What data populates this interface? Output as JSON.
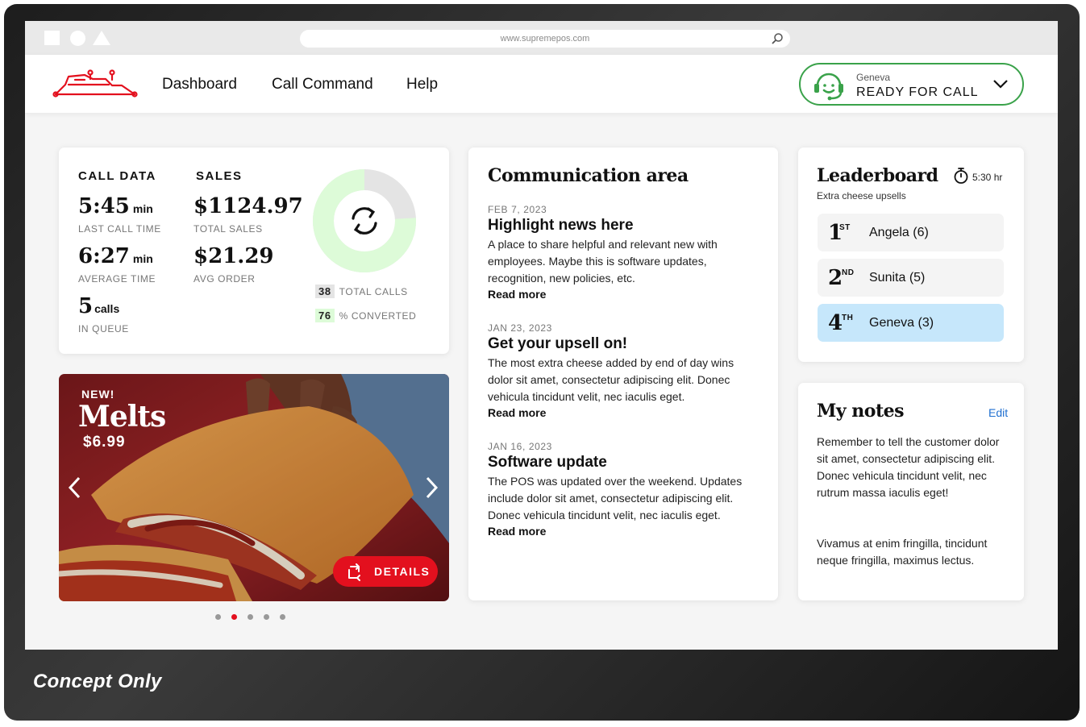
{
  "browser": {
    "url": "www.supremepos.com"
  },
  "nav": {
    "links": [
      "Dashboard",
      "Call Command",
      "Help"
    ],
    "agent_name": "Geneva",
    "status": "READY FOR CALL"
  },
  "call_data": {
    "heading": "CALL DATA",
    "last_call_time": {
      "value": "5:45",
      "unit": "min",
      "label": "LAST CALL TIME"
    },
    "average_time": {
      "value": "6:27",
      "unit": "min",
      "label": "AVERAGE TIME"
    },
    "in_queue": {
      "value": "5",
      "unit": "calls",
      "label": "IN QUEUE"
    }
  },
  "sales": {
    "heading": "SALES",
    "total_sales": {
      "value": "$1124.97",
      "label": "TOTAL SALES"
    },
    "avg_order": {
      "value": "$21.29",
      "label": "AVG ORDER"
    }
  },
  "conversion": {
    "total_calls": {
      "value": "38",
      "label": "TOTAL CALLS"
    },
    "converted": {
      "value": "76",
      "label": "% CONVERTED"
    },
    "converted_fraction": 0.76
  },
  "promo": {
    "badge": "NEW!",
    "title": "Melts",
    "price": "$6.99",
    "details_label": "DETAILS",
    "slide_count": 5,
    "active_slide": 1
  },
  "communication": {
    "title": "Communication area",
    "items": [
      {
        "date": "FEB 7, 2023",
        "title": "Highlight news here",
        "body": "A place to share helpful and relevant new with employees. Maybe this is software updates, recognition, new policies, etc.",
        "more": "Read more"
      },
      {
        "date": "JAN 23, 2023",
        "title": "Get your upsell on!",
        "body": "The most extra cheese added by end of day wins dolor sit amet, consectetur adipiscing elit. Donec vehicula tincidunt velit, nec iaculis eget.",
        "more": "Read more"
      },
      {
        "date": "JAN 16, 2023",
        "title": "Software update",
        "body": "The POS was updated over the weekend. Updates include dolor sit amet, consectetur adipiscing elit. Donec vehicula tincidunt velit, nec iaculis eget.",
        "more": "Read more"
      }
    ]
  },
  "leaderboard": {
    "title": "Leaderboard",
    "subtitle": "Extra cheese upsells",
    "timer": "5:30 hr",
    "rows": [
      {
        "rank": "1",
        "suffix": "ST",
        "name": "Angela (6)"
      },
      {
        "rank": "2",
        "suffix": "ND",
        "name": "Sunita (5)"
      },
      {
        "rank": "4",
        "suffix": "TH",
        "name": "Geneva (3)"
      }
    ]
  },
  "notes": {
    "title": "My notes",
    "edit": "Edit",
    "paragraphs": [
      "Remember to tell the customer dolor sit amet, consectetur adipiscing elit. Donec vehicula tincidunt velit, nec rutrum massa iaculis eget!",
      "Vivamus at enim fringilla, tincidunt neque fringilla, maximus lectus."
    ]
  },
  "footer": {
    "caption": "Concept Only"
  },
  "colors": {
    "brand_red": "#e3101e",
    "ready_green": "#3aa24a",
    "donut_fill": "#ddfbd8",
    "donut_rest": "#e4e4e4",
    "highlight_row": "#c6e7fb",
    "link_blue": "#1f6fd0"
  }
}
